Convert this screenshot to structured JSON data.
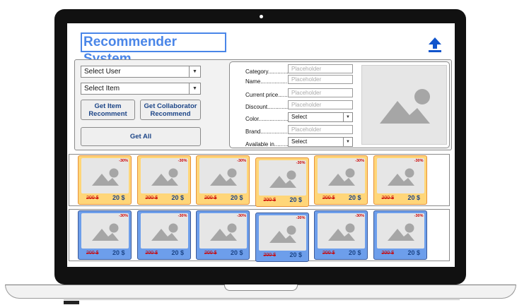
{
  "app": {
    "title": "Recommender System"
  },
  "controls": {
    "select_user": "Select User",
    "select_item": "Select Item",
    "btn_item": "Get Item Recomment",
    "btn_collab": "Get Collaborator Recommend",
    "btn_all": "Get All"
  },
  "details": {
    "category_label": "Category.............",
    "name_label": "Name.................",
    "price_label": "Current price.......",
    "discount_label": "Discount..............",
    "color_label": "Color...................",
    "brand_label": "Brand..................",
    "available_label": "Available in.........",
    "placeholder": "Placeholder",
    "select": "Select"
  },
  "products": {
    "discount": "-30%",
    "old_price": "200 $",
    "new_price": "20 $",
    "orange_count": 6,
    "blue_count": 6
  },
  "colors": {
    "title_blue": "#4a86e8",
    "orange_card": "#ffd679",
    "blue_card": "#6d9eeb",
    "price_red": "#cc0000"
  }
}
